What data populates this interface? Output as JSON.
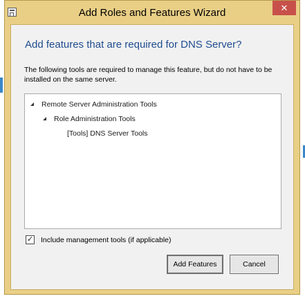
{
  "window": {
    "title": "Add Roles and Features Wizard",
    "close_glyph": "✕"
  },
  "dialog": {
    "heading": "Add features that are required for DNS Server?",
    "description": "The following tools are required to manage this feature, but do not have to be installed on the same server.",
    "tree": [
      {
        "label": "Remote Server Administration Tools",
        "level": 0,
        "expanded": true
      },
      {
        "label": "Role Administration Tools",
        "level": 1,
        "expanded": true
      },
      {
        "label": "[Tools] DNS Server Tools",
        "level": 2,
        "expanded": false
      }
    ],
    "include_tools": {
      "label": "Include management tools (if applicable)",
      "checked": true,
      "check_glyph": "✓"
    }
  },
  "buttons": {
    "add_features": "Add Features",
    "cancel": "Cancel"
  },
  "colors": {
    "frame": "#e9cf86",
    "heading": "#1f4c8f",
    "close": "#c7514a"
  }
}
